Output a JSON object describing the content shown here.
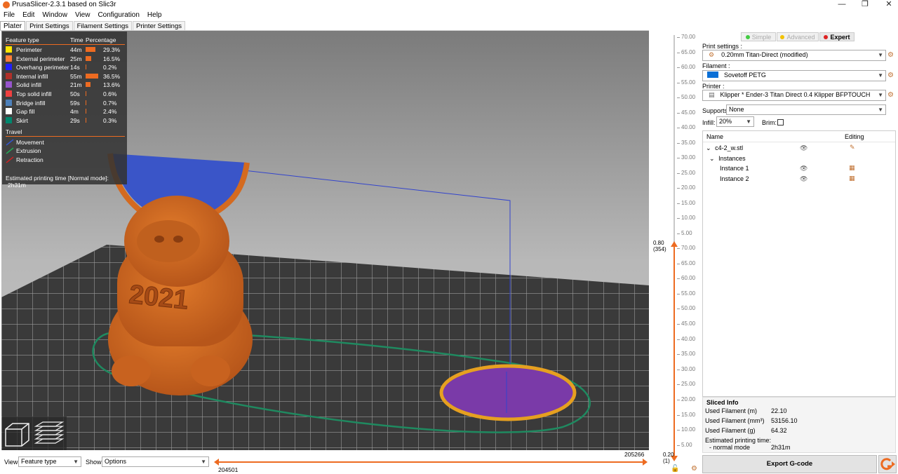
{
  "window": {
    "title": "PrusaSlicer-2.3.1 based on Slic3r"
  },
  "menu": [
    "File",
    "Edit",
    "Window",
    "View",
    "Configuration",
    "Help"
  ],
  "tabs": [
    "Plater",
    "Print Settings",
    "Filament Settings",
    "Printer Settings"
  ],
  "legend": {
    "headers": {
      "feature": "Feature type",
      "time": "Time",
      "percentage": "Percentage"
    },
    "features": [
      {
        "name": "Perimeter",
        "time": "44m",
        "pct": "29.3%",
        "frac": 0.293,
        "color": "#ffe600"
      },
      {
        "name": "External perimeter",
        "time": "25m",
        "pct": "16.5%",
        "frac": 0.165,
        "color": "#ff7d38"
      },
      {
        "name": "Overhang perimeter",
        "time": "14s",
        "pct": "0.2%",
        "frac": 0.002,
        "color": "#1f1fff"
      },
      {
        "name": "Internal infill",
        "time": "55m",
        "pct": "36.5%",
        "frac": 0.365,
        "color": "#b03029"
      },
      {
        "name": "Solid infill",
        "time": "21m",
        "pct": "13.6%",
        "frac": 0.136,
        "color": "#9654cc"
      },
      {
        "name": "Top solid infill",
        "time": "50s",
        "pct": "0.6%",
        "frac": 0.006,
        "color": "#f04040"
      },
      {
        "name": "Bridge infill",
        "time": "59s",
        "pct": "0.7%",
        "frac": 0.007,
        "color": "#4d80ba"
      },
      {
        "name": "Gap fill",
        "time": "4m",
        "pct": "2.4%",
        "frac": 0.024,
        "color": "#ffffff"
      },
      {
        "name": "Skirt",
        "time": "29s",
        "pct": "0.3%",
        "frac": 0.003,
        "color": "#00876e"
      }
    ],
    "travel_header": "Travel",
    "travel": [
      {
        "name": "Movement",
        "color": "#3355cc"
      },
      {
        "name": "Extrusion",
        "color": "#22aa55"
      },
      {
        "name": "Retraction",
        "color": "#cc2222"
      }
    ],
    "estimated": {
      "label": "Estimated printing time [Normal mode]:",
      "value": "2h31m"
    }
  },
  "scene": {
    "model_label": "2021"
  },
  "bottom": {
    "view_label": "View",
    "view_value": "Feature type",
    "show_label": "Show",
    "show_value": "Options",
    "hslider_left": "204501",
    "hslider_right": "205266"
  },
  "vslider": {
    "top_ticks": [
      "70.00",
      "65.00",
      "60.00",
      "55.00",
      "50.00",
      "45.00",
      "40.00",
      "35.00",
      "30.00",
      "25.00",
      "20.00",
      "15.00",
      "10.00",
      "5.00"
    ],
    "bottom_ticks": [
      "70.00",
      "65.00",
      "60.00",
      "55.00",
      "50.00",
      "45.00",
      "40.00",
      "35.00",
      "30.00",
      "25.00",
      "20.00",
      "15.00",
      "10.00",
      "5.00"
    ],
    "upper_value": "0.80",
    "upper_layer": "(354)",
    "lower_value": "0.20",
    "lower_layer": "(1)"
  },
  "modes": {
    "simple": "Simple",
    "advanced": "Advanced",
    "expert": "Expert"
  },
  "settings": {
    "print_label": "Print settings :",
    "print_value": "0.20mm Titan-Direct (modified)",
    "filament_label": "Filament :",
    "filament_value": "Sovetoff PETG",
    "filament_color": "#0a6fd6",
    "printer_label": "Printer :",
    "printer_value": "Klipper * Ender-3 Titan Direct 0.4 Klipper BFPTOUCH",
    "supports_label": "Supports:",
    "supports_value": "None",
    "infill_label": "Infill:",
    "infill_value": "20%",
    "brim_label": "Brim:"
  },
  "objects": {
    "col_name": "Name",
    "col_editing": "Editing",
    "object": "c4-2_w.stl",
    "instances_label": "Instances",
    "instances": [
      "Instance 1",
      "Instance 2"
    ]
  },
  "sliced_info": {
    "title": "Sliced Info",
    "rows": [
      {
        "k": "Used Filament (m)",
        "v": "22.10"
      },
      {
        "k": "Used Filament (mm³)",
        "v": "53156.10"
      },
      {
        "k": "Used Filament (g)",
        "v": "64.32"
      }
    ],
    "time_label": "Estimated printing time:",
    "time_mode": "- normal mode",
    "time_value": "2h31m"
  },
  "export_label": "Export G-code"
}
